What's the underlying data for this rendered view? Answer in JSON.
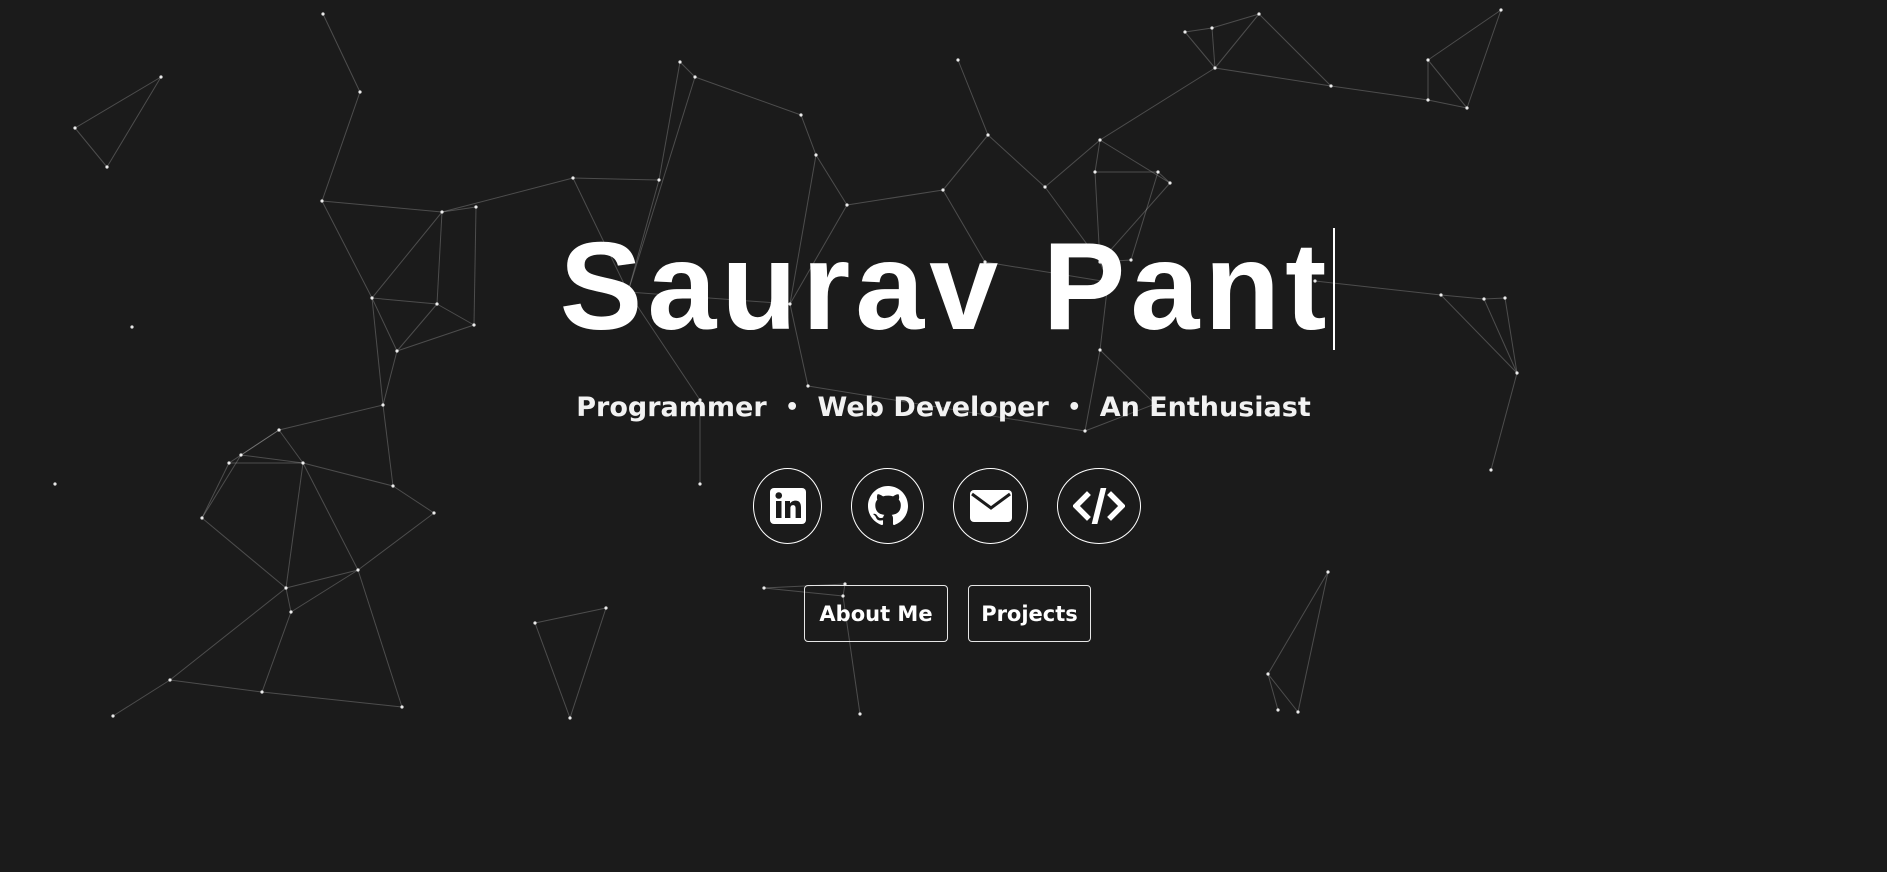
{
  "hero": {
    "name": "Saurav Pant",
    "roles": [
      "Programmer",
      "Web Developer",
      "An Enthusiast"
    ],
    "separator": "•"
  },
  "social_links": [
    {
      "icon": "linkedin-icon"
    },
    {
      "icon": "github-icon"
    },
    {
      "icon": "envelope-icon"
    },
    {
      "icon": "code-icon"
    }
  ],
  "buttons": {
    "about_label": "About Me",
    "projects_label": "Projects"
  },
  "colors": {
    "background": "#1b1b1b",
    "text": "#ffffff",
    "network_line": "#ffffff",
    "network_node": "#ffffff"
  }
}
